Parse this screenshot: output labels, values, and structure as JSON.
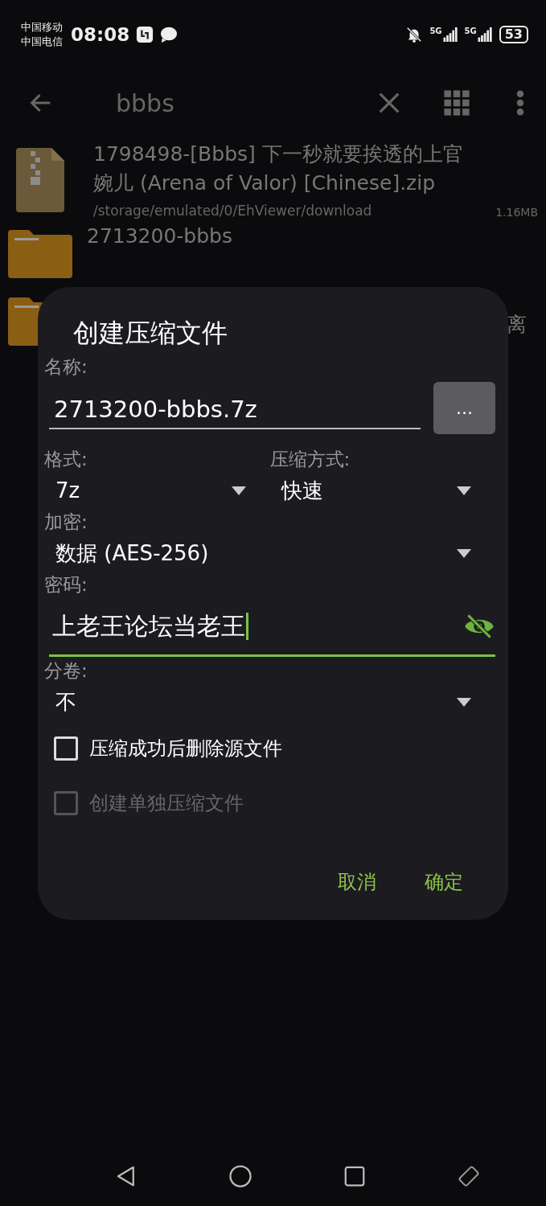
{
  "status_bar": {
    "carriers": [
      "中国移动",
      "中国电信"
    ],
    "time": "08:08",
    "networks": [
      "5G",
      "5G"
    ],
    "battery": "53"
  },
  "toolbar": {
    "title": "bbbs"
  },
  "files": [
    {
      "kind": "zip",
      "name": "1798498-[Bbbs] 下一秒就要挨透的上官婉儿 (Arena of Valor) [Chinese].zip",
      "path": "/storage/emulated/0/EhViewer/download",
      "size": "1.16MB"
    },
    {
      "kind": "folder",
      "name": "2713200-bbbs"
    },
    {
      "kind": "folder",
      "name": "离"
    }
  ],
  "dialog": {
    "title": "创建压缩文件",
    "name": {
      "label": "名称:",
      "value": "2713200-bbbs.7z",
      "browse": "..."
    },
    "format": {
      "label": "格式:",
      "value": "7z"
    },
    "method": {
      "label": "压缩方式:",
      "value": "快速"
    },
    "encryption": {
      "label": "加密:",
      "value": "数据 (AES-256)"
    },
    "password": {
      "label": "密码:",
      "value": "上老王论坛当老王",
      "visible": true
    },
    "split": {
      "label": "分卷:",
      "value": "不"
    },
    "checkboxes": [
      {
        "label": "压缩成功后删除源文件",
        "checked": false,
        "disabled": false
      },
      {
        "label": "创建单独压缩文件",
        "checked": false,
        "disabled": true
      }
    ],
    "buttons": [
      "取消",
      "确定"
    ]
  }
}
